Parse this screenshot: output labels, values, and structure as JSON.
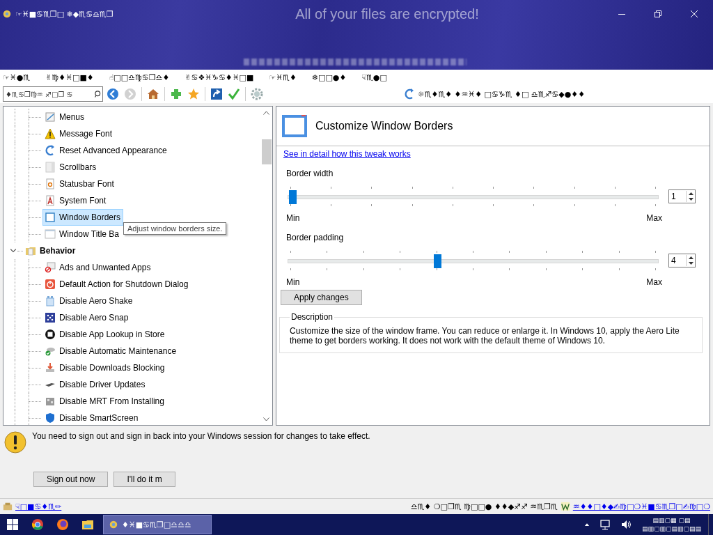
{
  "window": {
    "title": "☞♓■♋♏❒□ ❄◆♏♋♎♏❒",
    "banner": "All of your files are encrypted!"
  },
  "menu": [
    "☞♓●♏",
    "✌♍♦♓□■♦",
    "☝□□♎♍♋❒♎♦",
    "✌♋❖♓♑♋♦♓□■",
    "☞♓♏♦",
    "❄□□●♦",
    "☟♏●□"
  ],
  "toolbar": {
    "placeholder": "♦♏♋❒♍♒ ♐□❒ ♋",
    "forward_disabled": true,
    "reset_label": "☼♏♦♏♦ ♦♒♓♦ □♋♑♏ ♦□ ♎♏♐♋◆●♦♦"
  },
  "tree": [
    {
      "children": [
        {
          "label": "Menus",
          "selected": false
        },
        {
          "label": "Message Font",
          "selected": false
        },
        {
          "label": "Reset Advanced Appearance",
          "selected": false
        },
        {
          "label": "Scrollbars",
          "selected": false
        },
        {
          "label": "Statusbar Font",
          "selected": false
        },
        {
          "label": "System Font",
          "selected": false
        },
        {
          "label": "Window Borders",
          "selected": true
        },
        {
          "label": "Window Title Ba",
          "selected": false
        }
      ]
    },
    {
      "label": "Behavior",
      "expanded": true,
      "children": [
        {
          "label": "Ads and Unwanted Apps",
          "selected": false
        },
        {
          "label": "Default Action for Shutdown Dialog",
          "selected": false
        },
        {
          "label": "Disable Aero Shake",
          "selected": false
        },
        {
          "label": "Disable Aero Snap",
          "selected": false
        },
        {
          "label": "Disable App Lookup in Store",
          "selected": false
        },
        {
          "label": "Disable Automatic Maintenance",
          "selected": false
        },
        {
          "label": "Disable Downloads Blocking",
          "selected": false
        },
        {
          "label": "Disable Driver Updates",
          "selected": false
        },
        {
          "label": "Disable MRT From Installing",
          "selected": false
        },
        {
          "label": "Disable SmartScreen",
          "selected": false
        }
      ]
    }
  ],
  "tooltip": "Adjust window borders size.",
  "panel": {
    "title": "Customize Window Borders",
    "link": "See in detail how this tweak works",
    "sliders": [
      {
        "label": "Border width",
        "level": 0,
        "value": "1",
        "min_label": "Min",
        "max_label": "Max"
      },
      {
        "label": "Border padding",
        "level": 0.4,
        "value": "4",
        "min_label": "Min",
        "max_label": "Max"
      }
    ],
    "apply_button": "Apply changes",
    "description": {
      "legend": "Description",
      "text": "Customize the size of the window frame. You can reduce or enlarge it. In Windows 10, apply the Aero Lite theme to get borders working. It does not work with the default theme of Windows 10."
    }
  },
  "notice": {
    "text": "You need to sign out and sign in back into your Windows session for changes to take effect.",
    "buttons": [
      "Sign out now",
      "I'll do it m"
    ]
  },
  "status_bar": {
    "donate": "☟□■♋♦♏✏",
    "text": "♎♏♦ ❍□❒♏ ♍□□● ♦♦◆♐♐ ♒♏❒♏",
    "link": "♒♦♦□♦◆✍♍□❍♓■♋♏❒□✍♍□❍"
  },
  "taskbar": {
    "window_button": {
      "label": "♦♓■♋♏❒□♎♎♎",
      "selected": true
    },
    "clock": [
      "▤▥▢▦ ▢▤",
      "▤▥▢▥▢▤▥▢▤▤"
    ]
  }
}
